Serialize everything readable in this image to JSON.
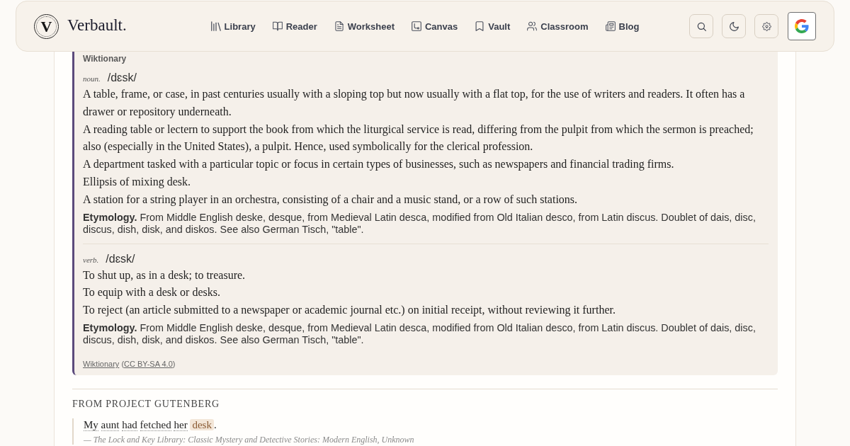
{
  "header": {
    "logo_letter": "V",
    "brand": "Verbault.",
    "nav": [
      {
        "label": "Library"
      },
      {
        "label": "Reader"
      },
      {
        "label": "Worksheet"
      },
      {
        "label": "Canvas"
      },
      {
        "label": "Vault"
      },
      {
        "label": "Classroom"
      },
      {
        "label": "Blog"
      }
    ]
  },
  "wiktionary": {
    "source_label": "Wiktionary",
    "entries": [
      {
        "pos": "noun.",
        "pronunciation": "/dɛsk/",
        "senses": [
          "A table, frame, or case, in past centuries usually with a sloping top but now usually with a flat top, for the use of writers and readers. It often has a drawer or repository underneath.",
          "A reading table or lectern to support the book from which the liturgical service is read, differing from the pulpit from which the sermon is preached; also (especially in the United States), a pulpit. Hence, used symbolically for the clerical profession.",
          "A department tasked with a particular topic or focus in certain types of businesses, such as newspapers and financial trading firms.",
          "Ellipsis of mixing desk.",
          "A station for a string player in an orchestra, consisting of a chair and a music stand, or a row of such stations."
        ],
        "etymology": "**Etymology.** From Middle English deske, desque, from Medieval Latin desca, modified from Old Italian desco, from Latin discus. Doublet of dais, disc, discus, dish, disk, and diskos. See also German Tisch, \"table\"."
      },
      {
        "pos": "verb.",
        "pronunciation": "/dɛsk/",
        "senses": [
          "To shut up, as in a desk; to treasure.",
          "To equip with a desk or desks.",
          "To reject (an article submitted to a newspaper or academic journal etc.) on initial receipt, without reviewing it further."
        ],
        "etymology": "**Etymology.** From Middle English deske, desque, from Medieval Latin desca, modified from Old Italian desco, from Latin discus. Doublet of dais, disc, discus, dish, disk, and diskos. See also German Tisch, \"table\"."
      }
    ],
    "attribution": [
      {
        "kind": "link",
        "text": "Wiktionary"
      },
      {
        "kind": "plain",
        "text": " ("
      },
      {
        "kind": "link",
        "text": "CC BY-SA 4.0"
      },
      {
        "kind": "plain",
        "text": ")"
      }
    ]
  },
  "gutenberg": {
    "heading": "FROM PROJECT GUTENBERG",
    "quotes": [
      {
        "text": "My aunt had fetched her",
        "match": "desk",
        "end": ".",
        "citation": "— The Lock and Key Library: Classic Mystery and Detective Stories: Modern English, Unknown"
      }
    ]
  }
}
